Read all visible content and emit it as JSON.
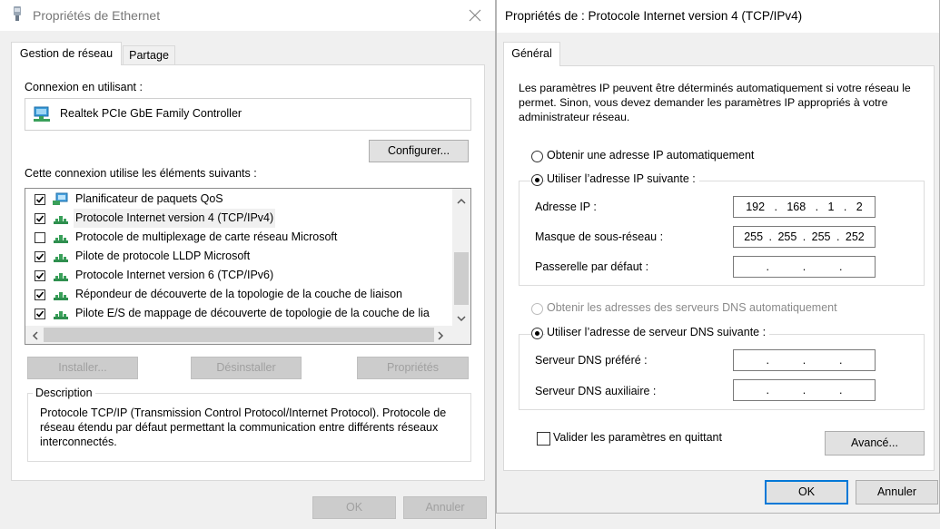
{
  "left_dialog": {
    "title": "Propriétés de Ethernet",
    "tabs": [
      "Gestion de réseau",
      "Partage"
    ],
    "connect_label": "Connexion en utilisant :",
    "adapter_name": "Realtek PCIe GbE Family Controller",
    "configure_button": "Configurer...",
    "items_label": "Cette connexion utilise les éléments suivants :",
    "items": [
      {
        "label": "Planificateur de paquets QoS",
        "checked": true,
        "icon": "qos-scheduler-icon"
      },
      {
        "label": "Protocole Internet version 4 (TCP/IPv4)",
        "checked": true,
        "icon": "network-protocol-icon",
        "selected": true
      },
      {
        "label": "Protocole de multiplexage de carte réseau Microsoft",
        "checked": false,
        "icon": "network-protocol-icon"
      },
      {
        "label": "Pilote de protocole LLDP Microsoft",
        "checked": true,
        "icon": "network-protocol-icon"
      },
      {
        "label": "Protocole Internet version 6 (TCP/IPv6)",
        "checked": true,
        "icon": "network-protocol-icon"
      },
      {
        "label": "Répondeur de découverte de la topologie de la couche de liaison",
        "checked": true,
        "icon": "network-protocol-icon"
      },
      {
        "label": "Pilote E/S de mappage de découverte de topologie de la couche de lia",
        "checked": true,
        "icon": "network-protocol-icon"
      }
    ],
    "install_button": "Installer...",
    "uninstall_button": "Désinstaller",
    "properties_button": "Propriétés",
    "description_label": "Description",
    "description_text": "Protocole TCP/IP (Transmission Control Protocol/Internet Protocol). Protocole de réseau étendu par défaut permettant la communication entre différents réseaux interconnectés.",
    "ok_button": "OK",
    "cancel_button": "Annuler"
  },
  "right_dialog": {
    "title": "Propriétés de : Protocole Internet version 4 (TCP/IPv4)",
    "tab": "Général",
    "intro": "Les paramètres IP peuvent être déterminés automatiquement si votre réseau le permet. Sinon, vous devez demander les paramètres IP appropriés à votre administrateur réseau.",
    "radio_auto_ip": "Obtenir une adresse IP automatiquement",
    "radio_manual_ip": "Utiliser l’adresse IP suivante :",
    "ip_label": "Adresse IP :",
    "ip_octets": [
      "192",
      "168",
      "1",
      "2"
    ],
    "mask_label": "Masque de sous-réseau :",
    "mask_octets": [
      "255",
      "255",
      "255",
      "252"
    ],
    "gateway_label": "Passerelle par défaut :",
    "gateway_octets": [
      "",
      "",
      "",
      ""
    ],
    "radio_auto_dns": "Obtenir les adresses des serveurs DNS automatiquement",
    "radio_manual_dns": "Utiliser l’adresse de serveur DNS suivante :",
    "dns_pref_label": "Serveur DNS préféré :",
    "dns_pref_octets": [
      "",
      "",
      "",
      ""
    ],
    "dns_alt_label": "Serveur DNS auxiliaire :",
    "dns_alt_octets": [
      "",
      "",
      "",
      ""
    ],
    "validate_label": "Valider les paramètres en quittant",
    "advanced_button": "Avancé...",
    "ok_button": "OK",
    "cancel_button": "Annuler"
  },
  "colors": {
    "accent": "#0078d7",
    "disabled_text": "#a0a0a0",
    "window_bg": "#f0f0f0"
  }
}
